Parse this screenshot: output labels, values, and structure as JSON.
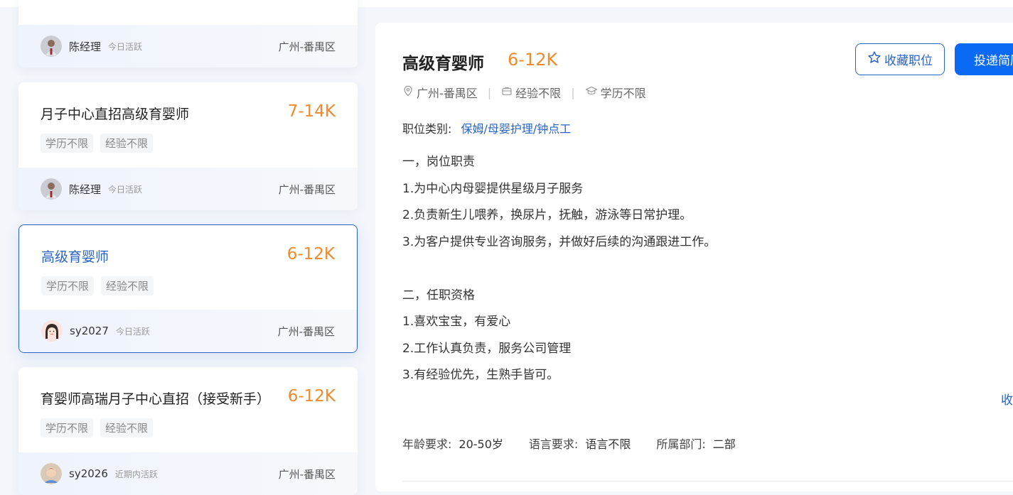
{
  "cards": [
    {
      "title": "",
      "salary": "",
      "tags": [],
      "hr_name": "陈经理",
      "hr_active": "今日活跃",
      "location": "广州-番禺区"
    },
    {
      "title": "月子中心直招高级育婴师",
      "salary": "7-14K",
      "tags": [
        "学历不限",
        "经验不限"
      ],
      "hr_name": "陈经理",
      "hr_active": "今日活跃",
      "location": "广州-番禺区"
    },
    {
      "title": "高级育婴师",
      "salary": "6-12K",
      "tags": [
        "学历不限",
        "经验不限"
      ],
      "hr_name": "sy2027",
      "hr_active": "今日活跃",
      "location": "广州-番禺区"
    },
    {
      "title": "育婴师高瑞月子中心直招（接受新手）",
      "salary": "6-12K",
      "tags": [
        "学历不限",
        "经验不限"
      ],
      "hr_name": "sy2026",
      "hr_active": "近期内活跃",
      "location": "广州-番禺区"
    }
  ],
  "detail": {
    "title": "高级育婴师",
    "salary": "6-12K",
    "fav_label": "收藏职位",
    "apply_label": "投递简历",
    "location": "广州-番禺区",
    "experience": "经验不限",
    "education": "学历不限",
    "category_label": "职位类别:",
    "category_value": "保姆/母婴护理/钟点工",
    "description": [
      "一，岗位职责",
      "1.为中心内母婴提供星级月子服务",
      "2.负责新生儿喂养，换尿片，抚触，游泳等日常护理。",
      "3.为客户提供专业咨询服务，并做好后续的沟通跟进工作。",
      "",
      "二，任职资格",
      "1.喜欢宝宝，有爱心",
      "2.工作认真负责，服务公司管理",
      "3.有经验优先，生熟手皆可。"
    ],
    "collapse_label": "收",
    "requirements": {
      "age_label": "年龄要求:",
      "age_value": "20-50岁",
      "lang_label": "语言要求:",
      "lang_value": "语言不限",
      "dept_label": "所属部门:",
      "dept_value": "二部"
    }
  },
  "colors": {
    "accent": "#2b63c5",
    "salary": "#f08a2d",
    "apply": "#0a6af4"
  }
}
